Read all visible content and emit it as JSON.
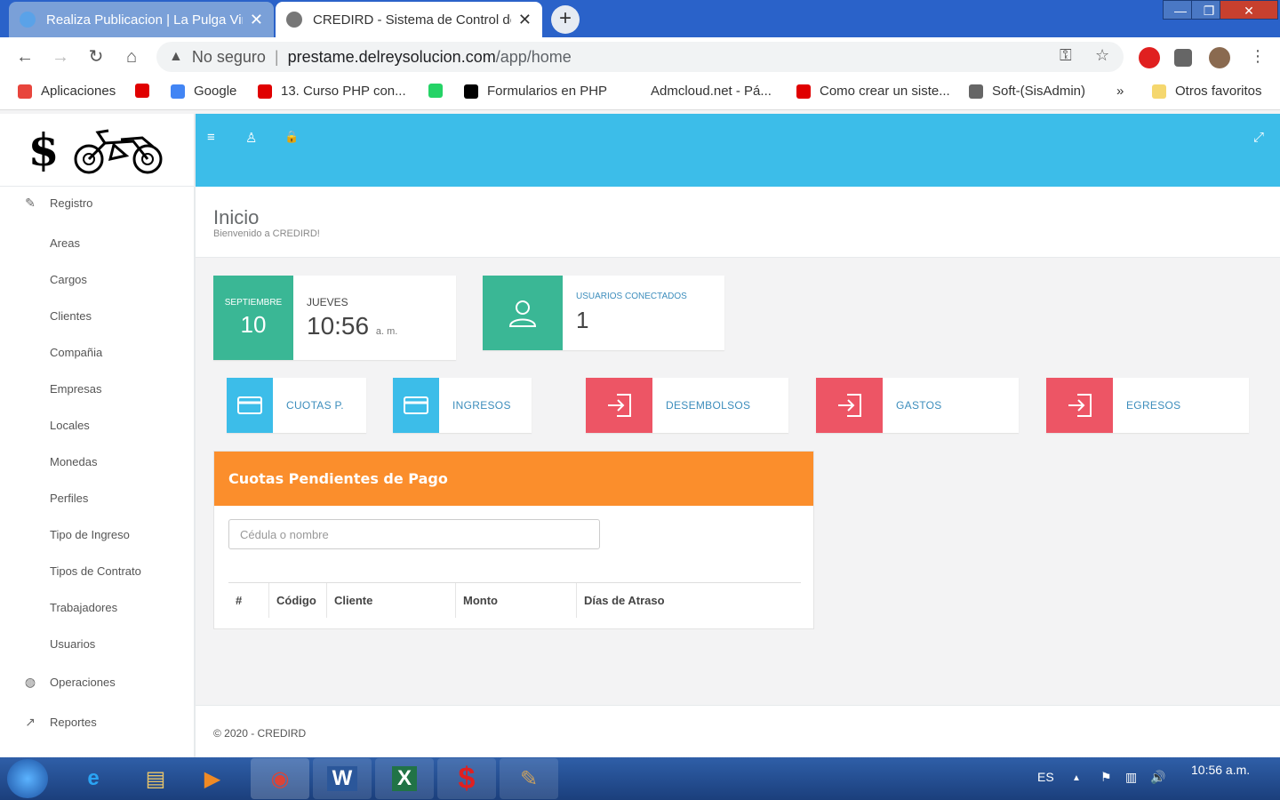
{
  "browser": {
    "tabs": [
      {
        "title": "Realiza Publicacion | La Pulga Virtual",
        "close": "✕"
      },
      {
        "title": "CREDIRD - Sistema de Control de Préstamos",
        "close": "✕"
      }
    ],
    "new_tab": "+",
    "window_controls": [
      "—",
      "❐",
      "✕"
    ],
    "nav": {
      "back": "←",
      "forward": "→",
      "reload": "↻",
      "home": "⌂"
    },
    "omnibox": {
      "security_icon": "▲",
      "security_label": "No seguro",
      "separator": "|",
      "host": "prestame.delreysolucion.com",
      "path": "/app/home"
    },
    "omnibox_icons": {
      "key": "⚿",
      "star": "☆"
    },
    "menu_icon": "⋮",
    "bookmarks": [
      {
        "label": "Aplicaciones",
        "color": "#e8453c"
      },
      {
        "label": "",
        "color": "#e00000"
      },
      {
        "label": "Google",
        "color": "#4285f4"
      },
      {
        "label": "13. Curso PHP con...",
        "color": "#e00000"
      },
      {
        "label": "",
        "color": "#25d366"
      },
      {
        "label": "Formularios en PHP",
        "color": "#000000"
      },
      {
        "label": "Admcloud.net - Pá...",
        "color": "#ffffff"
      },
      {
        "label": "Como crear un siste...",
        "color": "#e00000"
      },
      {
        "label": "Soft-(SisAdmin)",
        "color": "#666666"
      }
    ],
    "bookmarks_more": "»",
    "other_bookmarks": "Otros favoritos"
  },
  "app": {
    "logo_symbol": "$",
    "sidebar": {
      "registro": {
        "label": "Registro",
        "icon": "✎"
      },
      "sub_items": [
        "Areas",
        "Cargos",
        "Clientes",
        "Compañia",
        "Empresas",
        "Locales",
        "Monedas",
        "Perfiles",
        "Tipo de Ingreso",
        "Tipos de Contrato",
        "Trabajadores",
        "Usuarios"
      ],
      "operaciones": {
        "label": "Operaciones",
        "icon": "◍"
      },
      "reportes": {
        "label": "Reportes",
        "icon": "↗"
      }
    },
    "topbar": {
      "menu_icon": "≡",
      "user_icon": "♙",
      "lock_icon": "🔒",
      "expand_icon": "⤢"
    },
    "page": {
      "title": "Inicio",
      "subtitle": "Bienvenido a CREDIRD!"
    },
    "date_box": {
      "month": "SEPTIEMBRE",
      "day": "10",
      "weekday": "JUEVES",
      "time": "10:56",
      "ampm": "a. m."
    },
    "users_box": {
      "label": "USUARIOS CONECTADOS",
      "count": "1"
    },
    "actions": [
      {
        "label": "CUOTAS P.",
        "color": "#3cbde9"
      },
      {
        "label": "INGRESOS",
        "color": "#3cbde9"
      },
      {
        "label": "DESEMBOLSOS",
        "color": "#ed5565"
      },
      {
        "label": "GASTOS",
        "color": "#ed5565"
      },
      {
        "label": "EGRESOS",
        "color": "#ed5565"
      }
    ],
    "panel": {
      "title": "Cuotas Pendientes de Pago",
      "search_placeholder": "Cédula o nombre",
      "columns": [
        "#",
        "Código",
        "Cliente",
        "Monto",
        "Días de Atraso"
      ]
    },
    "footer": "© 2020 - CREDIRD"
  },
  "taskbar": {
    "lang": "ES",
    "clock_time": "10:56 a.m.",
    "apps": [
      {
        "label": "e",
        "color": "#2aa4f4"
      },
      {
        "label": "▤",
        "color": "#e8c46a"
      },
      {
        "label": "▶",
        "color": "#f08a24"
      },
      {
        "label": "◉",
        "color": "#db4437"
      },
      {
        "label": "W",
        "color": "#2b579a"
      },
      {
        "label": "X",
        "color": "#217346"
      },
      {
        "label": "$",
        "color": "#e02020"
      },
      {
        "label": "✎",
        "color": "#c8a060"
      }
    ],
    "tray_icons": [
      "▲",
      "⚑",
      "▥",
      "🔊"
    ]
  },
  "colors": {
    "aqua": "#3cbde9",
    "green": "#3ab795",
    "red": "#ed5565",
    "orange": "#fb8e2c"
  }
}
